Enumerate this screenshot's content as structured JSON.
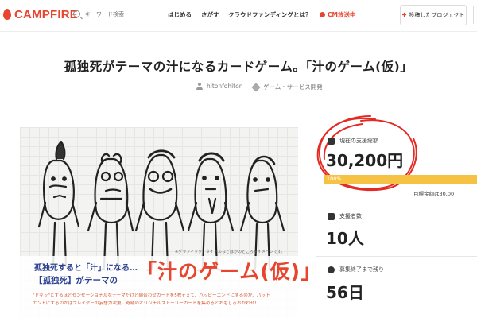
{
  "header": {
    "logo_text": "CAMPFIRE",
    "search_placeholder": "キーワード検索",
    "nav": [
      "はじめる",
      "さがす",
      "クラウドファンディングとは？",
      "CM放送中"
    ],
    "post_button": "投稿したプロジェクト"
  },
  "project": {
    "title": "孤独死がテーマの汁になるカードゲーム。「汁のゲーム(仮)」",
    "owner": "hitonfohiton",
    "category": "ゲーム・サービス開発"
  },
  "image": {
    "caption": "※グラフィック・タイトルなどはかのところをイメージです。",
    "line1": "孤独死すると「汁」になる…",
    "line2": "【孤独死】がテーマの",
    "big_title": "「汁のゲーム(仮)」",
    "desc1": "\"ドキッ\"とするほどセンセーショナルなテーマだけど組合わせカードを5枚そえて、ハッピーエンドにするのか、バット",
    "desc2": "エンドにするのかはプレイヤーの妄想力次第。奇跡のオリジナルストーリーカードを集めるとおもしろおかわせ!"
  },
  "stats": {
    "raised_label": "現在の支援総額",
    "raised_value": "30,200円",
    "progress_text": "100%",
    "progress_fraction": 1.0,
    "goal_text": "目標金額は30,00",
    "backers_label": "支援者数",
    "backers_value": "10人",
    "remaining_label": "募集終了まで残り",
    "remaining_value": "56日"
  },
  "colors": {
    "brand": "#e8452f",
    "progress": "#f5c243",
    "banner_blue": "#2b3f8f"
  },
  "icons": [
    "search-icon",
    "cm-dot-icon",
    "post-icon",
    "user-icon",
    "tag-icon",
    "money-icon",
    "people-icon",
    "clock-icon"
  ]
}
